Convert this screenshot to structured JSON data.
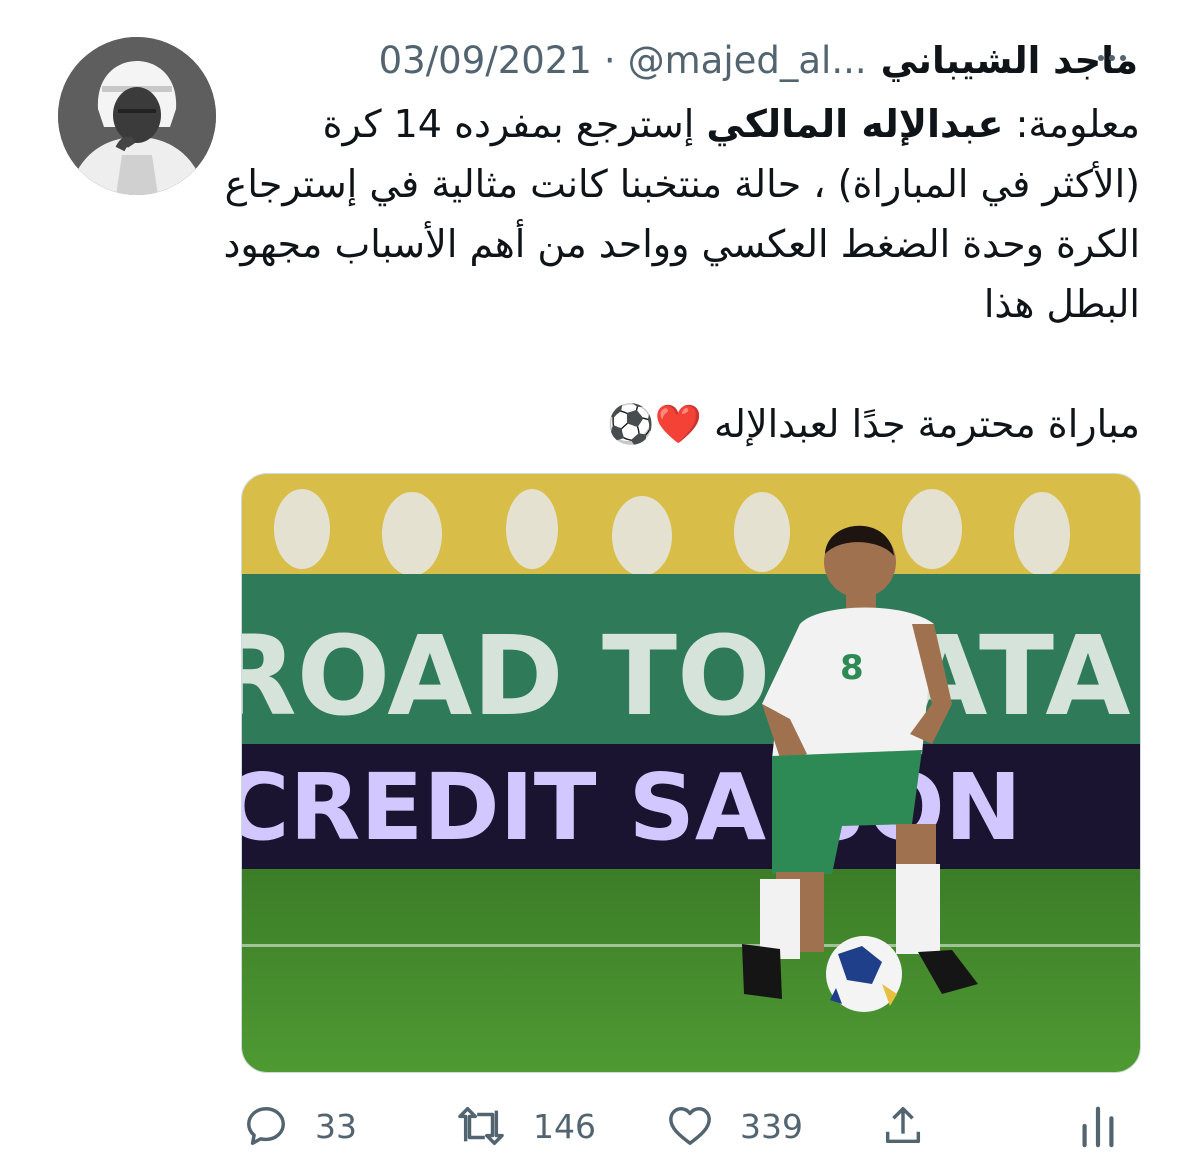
{
  "tweet": {
    "display_name": "ماجد الشيباني",
    "handle": "@majed_al...",
    "separator": "·",
    "date": "03/09/2021",
    "more_icon": "more-horizontal-icon",
    "text_prefix": "معلومة: ",
    "mention": "عبدالإله المالكي",
    "text_rest": " إسترجع بمفرده 14 كرة (الأكثر في المباراة) ، حالة منتخبنا كانت مثالية في إسترجاع الكرة وحدة الضغط العكسي وواحد من أهم الأسباب مجهود البطل هذا",
    "second_line": "مباراة محترمة جدًا لعبدالإله",
    "emojis": "❤️⚽",
    "media": {
      "banner_text": "ROAD TO QATAR",
      "board_text": "CREDIT SAISON",
      "shirt_number": "8"
    }
  },
  "actions": {
    "reply": {
      "icon": "reply-icon",
      "count": "33"
    },
    "retweet": {
      "icon": "retweet-icon",
      "count": "146"
    },
    "like": {
      "icon": "heart-icon",
      "count": "339"
    },
    "share": {
      "icon": "share-icon"
    },
    "analytics": {
      "icon": "analytics-icon"
    }
  },
  "colors": {
    "text": "#0f1419",
    "secondary": "#536471",
    "pitch": "#3f8a2c",
    "banner": "#2f7a58"
  }
}
